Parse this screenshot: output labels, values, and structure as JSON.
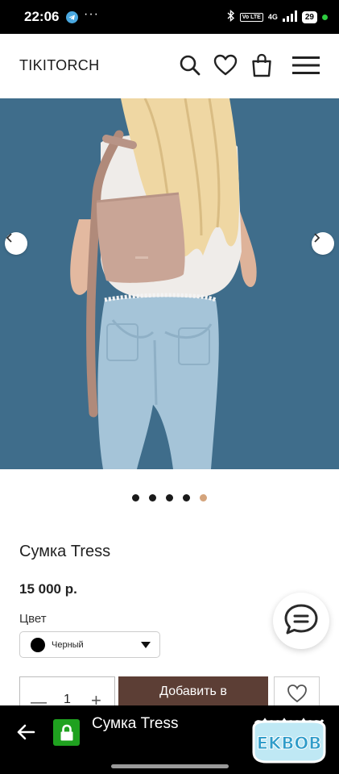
{
  "status_bar": {
    "time": "22:06",
    "more": "···",
    "volte": "Vo LTE",
    "network": "4G",
    "battery": "29"
  },
  "header": {
    "logo": "TIKITORCH",
    "icons": [
      "search-icon",
      "heart-icon",
      "bag-icon",
      "menu-icon"
    ]
  },
  "gallery": {
    "image": "product-photo-bag-on-model",
    "slide_count": 5,
    "active_slide_index": 4
  },
  "product": {
    "title": "Сумка Tress",
    "price": "15 000 р.",
    "color_label": "Цвет",
    "color_value": "Черный",
    "color_swatch": "#000000",
    "quantity": "1",
    "add_to_cart_label": "Добавить в"
  },
  "browser_bar": {
    "tab_title": "Сумка Tress"
  },
  "watermark": {
    "text": "EKBOB"
  },
  "colors": {
    "accent_button": "#5c3e35",
    "active_dot": "#d4a47c",
    "lock_green": "#1fa11f",
    "hero_background": "#3f6d8b"
  }
}
